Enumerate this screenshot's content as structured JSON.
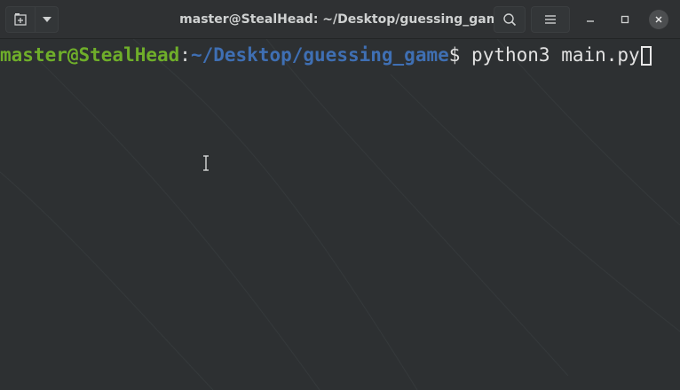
{
  "window": {
    "title": "master@StealHead: ~/Desktop/guessing_game"
  },
  "toolbar": {
    "new_tab_icon": "new-tab-icon",
    "tab_menu_icon": "chevron-down-icon",
    "search_icon": "search-icon",
    "menu_icon": "hamburger-menu-icon",
    "minimize_icon": "minimize-icon",
    "maximize_icon": "maximize-icon",
    "close_icon": "close-icon"
  },
  "terminal": {
    "prompt_user": "master@StealHead",
    "prompt_colon": ":",
    "prompt_path": "~/Desktop/guessing_game",
    "prompt_symbol": "$ ",
    "command": "python3 main.py"
  },
  "colors": {
    "background": "#2d3032",
    "prompt_user": "#6fae2a",
    "prompt_path": "#3f6fb3",
    "text": "#e2e2e2"
  }
}
